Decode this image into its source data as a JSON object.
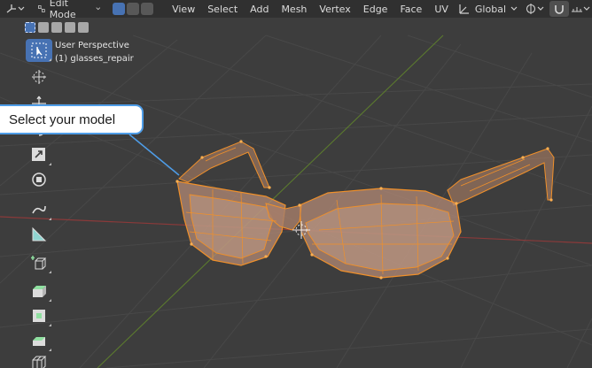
{
  "header": {
    "mode_label": "Edit Mode",
    "menus": [
      "View",
      "Select",
      "Add",
      "Mesh",
      "Vertex",
      "Edge",
      "Face",
      "UV"
    ],
    "orientation_label": "Global"
  },
  "viewport": {
    "perspective_label": "User Perspective",
    "object_label": "(1) glasses_repair"
  },
  "callout": {
    "text": "Select your model"
  },
  "colors": {
    "accent": "#4772b3",
    "mesh_wire": "#f0902a",
    "callout_border": "#4e9de8"
  },
  "icons": [
    "select-box-icon",
    "cursor-icon",
    "move-icon",
    "rotate-icon",
    "scale-icon",
    "transform-icon",
    "annotate-icon",
    "measure-icon",
    "add-cube-icon",
    "extrude-icon",
    "inset-icon",
    "bevel-icon",
    "loop-cut-icon"
  ]
}
